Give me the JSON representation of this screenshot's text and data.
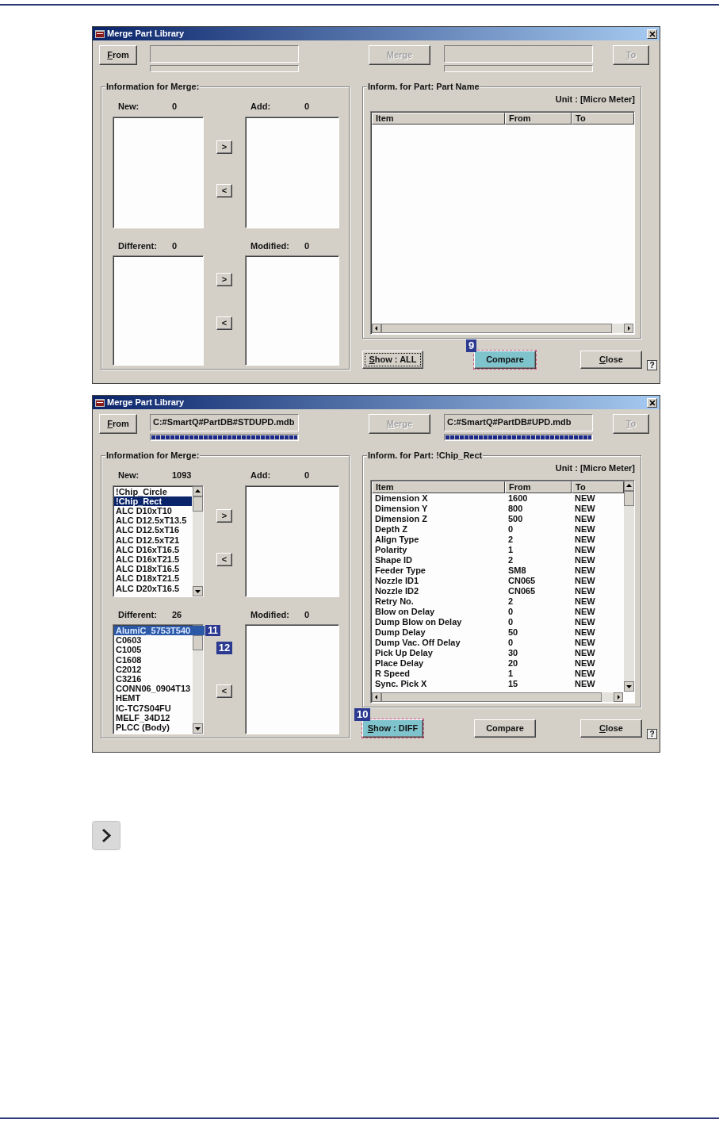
{
  "dialogs": [
    {
      "title": "Merge Part Library",
      "from_button": {
        "label": "From",
        "disabled": false,
        "mnemonic": true
      },
      "from_progress": {
        "level": 0
      },
      "merge_button": {
        "label": "Merge",
        "disabled": true,
        "mnemonic": true
      },
      "to_progress": {
        "level": 0
      },
      "to_button": {
        "label": "To",
        "disabled": true,
        "mnemonic": true
      },
      "merge_info": {
        "title": "Information for Merge:",
        "lists": [
          {
            "label": "New:",
            "count": "0"
          },
          {
            "label": "Add:",
            "count": "0"
          },
          {
            "label": "Different:",
            "count": "0"
          },
          {
            "label": "Modified:",
            "count": "0"
          }
        ],
        "arrows": [
          [
            {
              "kind": "button",
              "label": ">"
            },
            {
              "kind": "button",
              "label": "<"
            }
          ],
          [
            {
              "kind": "button",
              "label": ">"
            },
            {
              "kind": "button",
              "label": "<"
            }
          ]
        ]
      },
      "part_info": {
        "title": "Inform. for Part: Part Name",
        "unit": "Unit : [Micro Meter]",
        "columns": [
          "Item",
          "From",
          "To"
        ]
      },
      "help_button": "?",
      "buttons": [
        {
          "label": "Show : ALL",
          "mnemonic": true,
          "focused": true,
          "highlighted": false
        },
        {
          "label": "Compare",
          "mnemonic": false,
          "focused": false,
          "highlighted": true,
          "badge": "9"
        },
        {
          "label": "Close",
          "mnemonic": true,
          "focused": false,
          "highlighted": false
        }
      ]
    },
    {
      "title": "Merge Part Library",
      "from_button": {
        "label": "From",
        "disabled": false,
        "mnemonic": true
      },
      "from_path": "C:#SmartQ#PartDB#STDUPD.mdb",
      "from_progress": {
        "level": 1
      },
      "merge_button": {
        "label": "Merge",
        "disabled": true,
        "mnemonic": true
      },
      "to_path": "C:#SmartQ#PartDB#UPD.mdb",
      "to_progress": {
        "level": 1
      },
      "to_button": {
        "label": "To",
        "disabled": true,
        "mnemonic": true
      },
      "merge_info": {
        "title": "Information for Merge:",
        "lists": [
          {
            "label": "New:",
            "count": "1093",
            "items": [
              {
                "text": "!Chip_Circle",
                "selected": false
              },
              {
                "text": "!Chip_Rect",
                "selected": true
              },
              {
                "text": "ALC D10xT10",
                "selected": false
              },
              {
                "text": "ALC D12.5xT13.5",
                "selected": false
              },
              {
                "text": "ALC D12.5xT16",
                "selected": false
              },
              {
                "text": "ALC D12.5xT21",
                "selected": false
              },
              {
                "text": "ALC D16xT16.5",
                "selected": false
              },
              {
                "text": "ALC D16xT21.5",
                "selected": false
              },
              {
                "text": "ALC D18xT16.5",
                "selected": false
              },
              {
                "text": "ALC D18xT21.5",
                "selected": false
              },
              {
                "text": "ALC D20xT16.5",
                "selected": false
              }
            ]
          },
          {
            "label": "Add:",
            "count": "0"
          },
          {
            "label": "Different:",
            "count": "26",
            "items": [
              {
                "text": "AlumiC_5753T540",
                "selected": true,
                "badge": "11"
              },
              {
                "text": "C0603",
                "selected": false
              },
              {
                "text": "C1005",
                "selected": false
              },
              {
                "text": "C1608",
                "selected": false
              },
              {
                "text": "C2012",
                "selected": false
              },
              {
                "text": "C3216",
                "selected": false
              },
              {
                "text": "CONN06_0904T13",
                "selected": false
              },
              {
                "text": "HEMT",
                "selected": false
              },
              {
                "text": "IC-TC7S04FU",
                "selected": false
              },
              {
                "text": "MELF_34D12",
                "selected": false
              },
              {
                "text": "PLCC (Body)",
                "selected": false
              }
            ]
          },
          {
            "label": "Modified:",
            "count": "0"
          }
        ],
        "arrows": [
          [
            {
              "kind": "button",
              "label": ">"
            },
            {
              "kind": "button",
              "label": "<"
            }
          ],
          [
            {
              "kind": "badge",
              "label": "12"
            },
            {
              "kind": "button",
              "label": "<"
            }
          ]
        ]
      },
      "part_info": {
        "title": "Inform. for Part: !Chip_Rect",
        "unit": "Unit : [Micro Meter]",
        "columns": [
          "Item",
          "From",
          "To"
        ],
        "rows": [
          [
            "Dimension X",
            "1600",
            "NEW"
          ],
          [
            "Dimension Y",
            "800",
            "NEW"
          ],
          [
            "Dimension Z",
            "500",
            "NEW"
          ],
          [
            "Depth Z",
            "0",
            "NEW"
          ],
          [
            "Align Type",
            "2",
            "NEW"
          ],
          [
            "Polarity",
            "1",
            "NEW"
          ],
          [
            "Shape ID",
            "2",
            "NEW"
          ],
          [
            "Feeder Type",
            "SM8",
            "NEW"
          ],
          [
            "Nozzle ID1",
            "CN065",
            "NEW"
          ],
          [
            "Nozzle ID2",
            "CN065",
            "NEW"
          ],
          [
            "Retry No.",
            "2",
            "NEW"
          ],
          [
            "Blow on Delay",
            "0",
            "NEW"
          ],
          [
            "Dump Blow on Delay",
            "0",
            "NEW"
          ],
          [
            "Dump Delay",
            "50",
            "NEW"
          ],
          [
            "Dump Vac. Off Delay",
            "0",
            "NEW"
          ],
          [
            "Pick Up Delay",
            "30",
            "NEW"
          ],
          [
            "Place Delay",
            "20",
            "NEW"
          ],
          [
            "R Speed",
            "1",
            "NEW"
          ],
          [
            "Sync. Pick X",
            "15",
            "NEW"
          ]
        ]
      },
      "help_button": "?",
      "buttons": [
        {
          "label": "Show : DIFF",
          "mnemonic": true,
          "focused": false,
          "highlighted": true,
          "badge": "10"
        },
        {
          "label": "Compare",
          "mnemonic": false,
          "focused": false,
          "highlighted": false
        },
        {
          "label": "Close",
          "mnemonic": true,
          "focused": false,
          "highlighted": false
        }
      ]
    }
  ]
}
